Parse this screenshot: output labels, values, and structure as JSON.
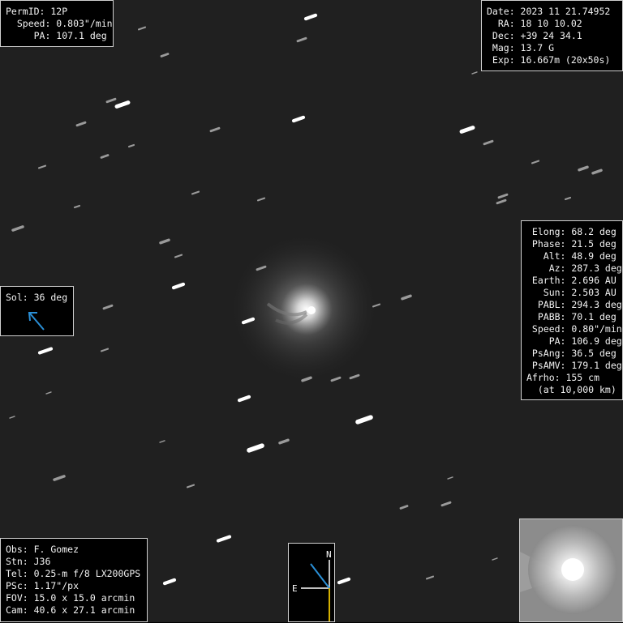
{
  "image": {
    "type": "astronomical comet image",
    "object": "comet nucleus with coma and tail, star trails in background"
  },
  "top_left": {
    "lines": [
      "PermID: 12P",
      "  Speed: 0.803\"/min",
      "     PA: 107.1 deg"
    ]
  },
  "top_right": {
    "lines": [
      "Date: 2023 11 21.74952",
      "  RA: 18 10 10.02",
      " Dec: +39 24 34.1",
      " Mag: 13.7 G",
      " Exp: 16.667m (20x50s)"
    ]
  },
  "right": {
    "lines": [
      " Elong: 68.2 deg",
      " Phase: 21.5 deg",
      "   Alt: 48.9 deg",
      "    Az: 287.3 deg",
      " Earth: 2.696 AU",
      "   Sun: 2.503 AU",
      "  PABL: 294.3 deg",
      "  PABB: 70.1 deg",
      " Speed: 0.80\"/min",
      "    PA: 106.9 deg",
      " PsAng: 36.5 deg",
      " PsAMV: 179.1 deg",
      "Afrho: 155 cm",
      "  (at 10,000 km)"
    ]
  },
  "sol": {
    "label": "Sol: 36 deg",
    "arrow_color": "#2a8fd6"
  },
  "bottom_left": {
    "lines": [
      "Obs: F. Gomez",
      "Stn: J36",
      "Tel: 0.25-m f/8 LX200GPS",
      "PSc: 1.17\"/px",
      "FOV: 15.0 x 15.0 arcmin",
      "Cam: 40.6 x 27.1 arcmin"
    ]
  },
  "compass": {
    "north_label": "N",
    "east_label": "E",
    "north_color": "#ffffff",
    "east_color": "#ffffff",
    "pa_line_color": "#2a8fd6",
    "sun_line_color": "#d4b000"
  },
  "inset": {
    "description": "zoomed nucleus"
  }
}
